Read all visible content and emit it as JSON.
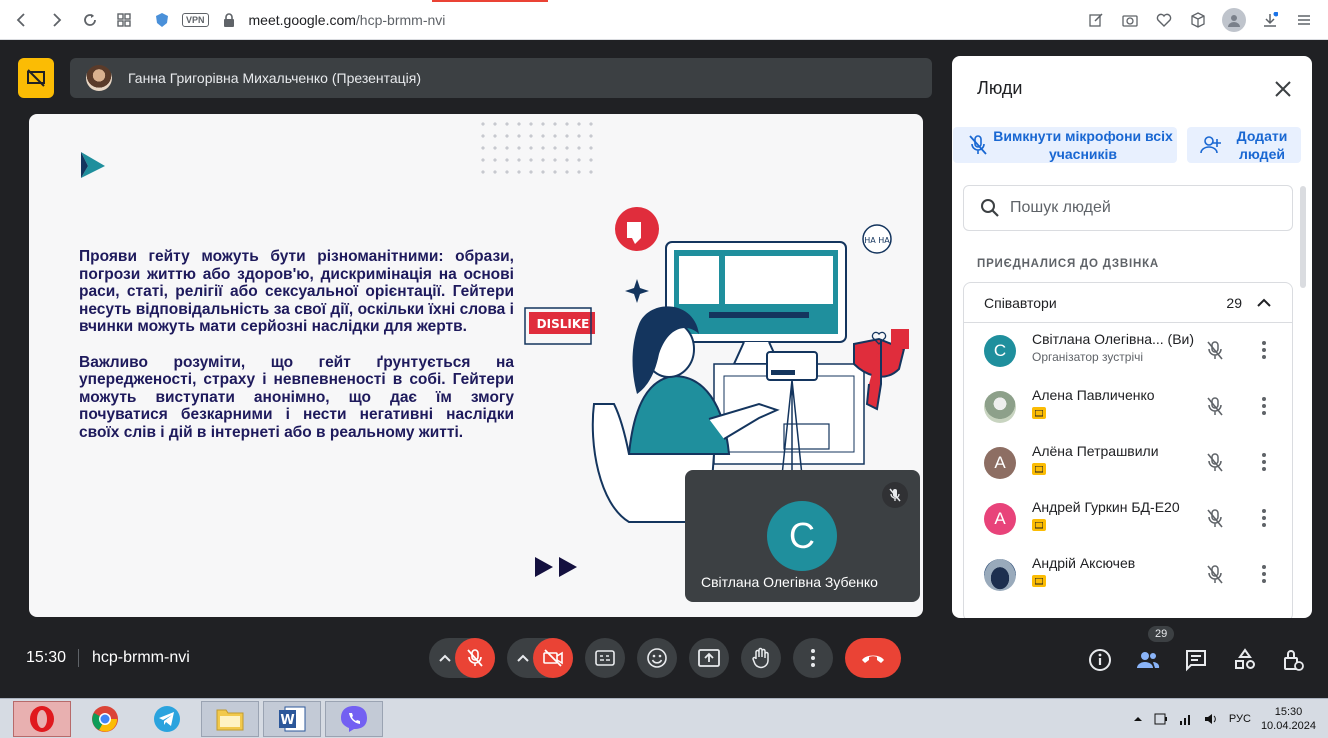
{
  "browser": {
    "url_host": "meet.google.com",
    "url_path": "/hcp-brmm-nvi",
    "vpn": "VPN"
  },
  "presenter": {
    "name": "Ганна Григорівна Михальченко (Презентація)"
  },
  "slide": {
    "paragraph1": "Прояви гейту можуть бути різноманітними: образи, погрози життю або здоров'ю, дискримінація на основі раси, статі, релігії або сексуальної орієнтації. Гейтери несуть відповідальність за свої дії, оскільки їхні слова і вчинки можуть мати серйозні наслідки для жертв.",
    "paragraph2": "Важливо розуміти, що гейт ґрунтується на упередженості, страху і невпевненості в собі. Гейтери можуть виступати анонімно, що дає їм змогу почуватися безкарними і нести негативні наслідки своїх слів і дій в інтернеті або в реальному житті.",
    "dislike_label": "DISLIKE",
    "bubble_text": "HA HA"
  },
  "self_view": {
    "initial": "С",
    "name": "Світлана Олегівна Зубенко"
  },
  "people_panel": {
    "title": "Люди",
    "mute_all": "Вимкнути мікрофони всіх учасників",
    "add_people": "Додати людей",
    "search_placeholder": "Пошук людей",
    "section": "ПРИЄДНАЛИСЯ ДО ДЗВІНКА",
    "group_name": "Співавтори",
    "group_count": "29",
    "participants": [
      {
        "initial": "С",
        "name": "Світлана Олегівна...  (Ви)",
        "subtitle": "Організатор зустрічі",
        "color": "#1f8f9d"
      },
      {
        "initial": "",
        "name": "Алена Павличенко",
        "subtitle": "",
        "color": "#9ca89a"
      },
      {
        "initial": "А",
        "name": "Алёна Петрашвили",
        "subtitle": "",
        "color": "#8d6e63"
      },
      {
        "initial": "А",
        "name": "Андрей Гуркин БД-Е20",
        "subtitle": "",
        "color": "#e8437a"
      },
      {
        "initial": "",
        "name": "Андрій Аксючев",
        "subtitle": "",
        "color": "#3d5a80"
      }
    ]
  },
  "bottom": {
    "time": "15:30",
    "meeting_code": "hcp-brmm-nvi",
    "people_count": "29"
  },
  "taskbar": {
    "lang": "РУС",
    "clock_time": "15:30",
    "clock_date": "10.04.2024"
  },
  "colors": {
    "accent_red": "#ea4335",
    "slide_text": "#1e1a5c",
    "teal": "#1f8f9d",
    "google_blue": "#1967d2"
  }
}
